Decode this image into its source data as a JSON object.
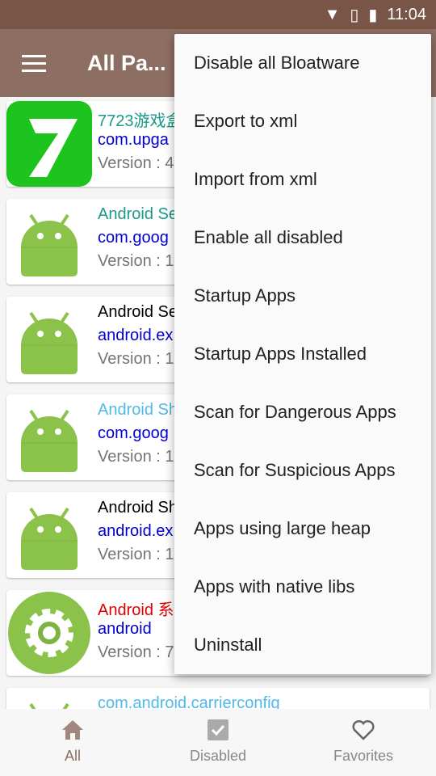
{
  "status": {
    "time": "11:04",
    "icons": [
      "wifi-icon",
      "no-sim-icon",
      "battery-charging-icon"
    ]
  },
  "appbar": {
    "title": "All Pa..."
  },
  "apps": [
    {
      "name": "7723游戏盒",
      "package": "com.upga",
      "version": "Version : 4",
      "title_color": "#1a9a8a",
      "icon": "7723-icon"
    },
    {
      "name": "Android Se",
      "package": "com.goog",
      "version": "Version : 1",
      "title_color": "#1a9a8a",
      "icon": "android-icon"
    },
    {
      "name": "Android Se",
      "package": "android.ex",
      "version": "Version : 1",
      "title_color": "#000000",
      "icon": "android-icon"
    },
    {
      "name": "Android Sh",
      "package": "com.goog",
      "version": "Version : 1",
      "title_color": "#4fb9e8",
      "icon": "android-icon"
    },
    {
      "name": "Android Sh",
      "package": "android.ex",
      "version": "Version : 1",
      "title_color": "#000000",
      "icon": "android-icon"
    },
    {
      "name": "Android 系",
      "package": "android",
      "version": "Version : 7",
      "title_color": "#e00000",
      "icon": "settings-icon"
    },
    {
      "name": "com.android.carrierconfig",
      "package": "",
      "version": "",
      "title_color": "#4fb9e8",
      "icon": "android-icon"
    }
  ],
  "menu": [
    "Disable all Bloatware",
    "Export to xml",
    "Import from xml",
    "Enable all disabled",
    "Startup Apps",
    "Startup Apps Installed",
    "Scan for Dangerous Apps",
    "Scan for Suspicious Apps",
    "Apps using large heap",
    "Apps with native libs",
    "Uninstall"
  ],
  "bottom_nav": [
    {
      "label": "All",
      "icon": "home-icon",
      "active": true
    },
    {
      "label": "Disabled",
      "icon": "checkbox-icon"
    },
    {
      "label": "Favorites",
      "icon": "heart-icon"
    }
  ],
  "colors": {
    "status_bar": "#795548",
    "app_bar": "#8d6e63"
  }
}
